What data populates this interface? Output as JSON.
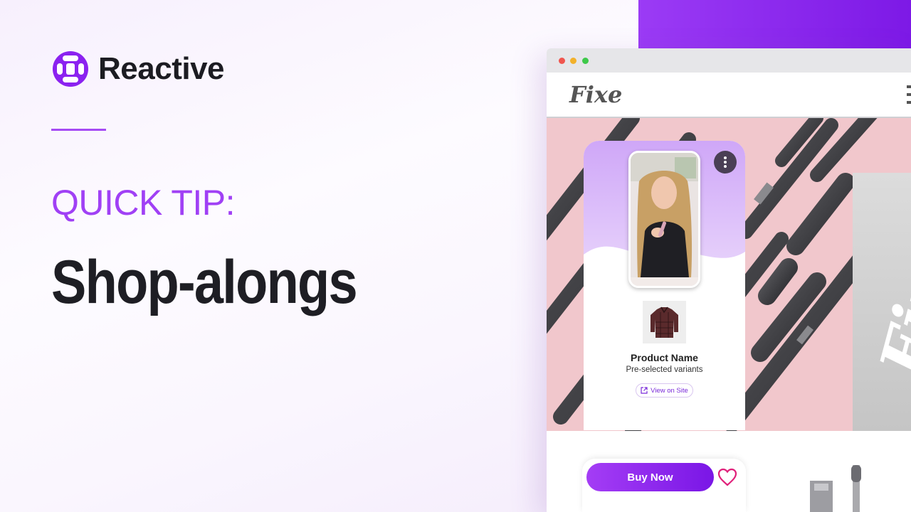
{
  "brand": {
    "name": "Reactive",
    "logo_icon": "reactive-logo-icon",
    "color": "#8b22f0"
  },
  "slide": {
    "tip_label": "QUICK TIP:",
    "title": "Shop-alongs",
    "accent_color": "#a040f5"
  },
  "browser": {
    "window_controls": [
      "close",
      "minimize",
      "maximize"
    ],
    "site": {
      "logo": "Fixe",
      "menu_icon": "hamburger-menu-icon",
      "side_banner_text": "Fixe"
    }
  },
  "widget": {
    "more_icon": "more-vertical-icon",
    "product": {
      "name": "Product Name",
      "variants": "Pre-selected variants",
      "view_link": "View on Site",
      "link_icon": "external-link-icon"
    },
    "buy_button": "Buy Now",
    "favorite_icon": "heart-icon"
  }
}
